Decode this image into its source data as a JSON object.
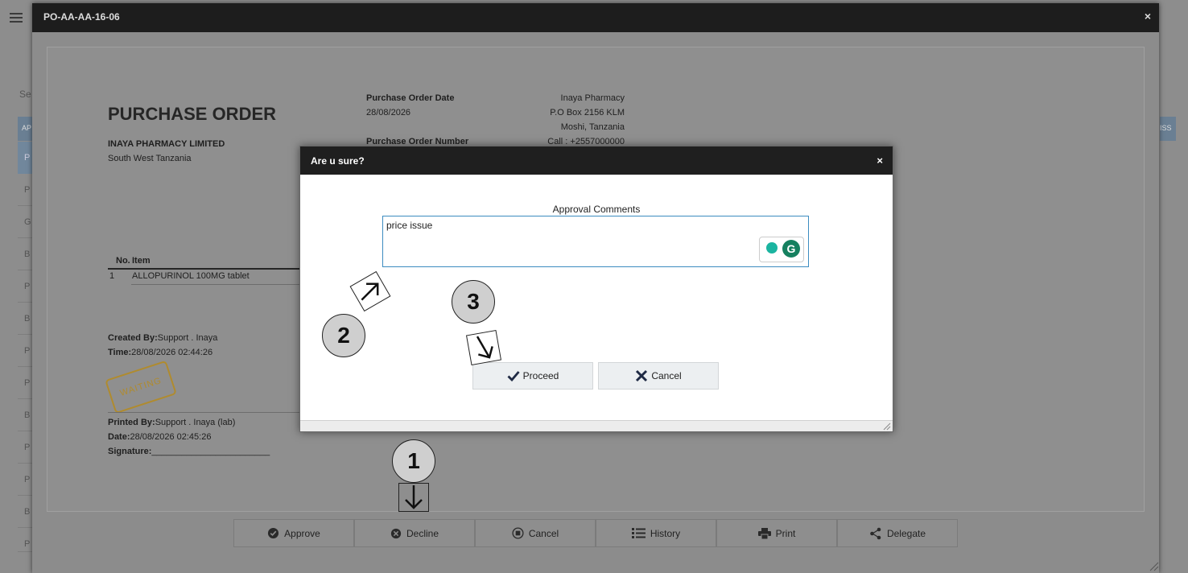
{
  "document_window": {
    "title": "PO-AA-AA-16-06",
    "close_symbol": "×"
  },
  "purchase_order": {
    "heading": "PURCHASE ORDER",
    "company_name": "INAYA PHARMACY LIMITED",
    "company_region": "South West Tanzania",
    "date_label": "Purchase Order Date",
    "date_value": "28/08/2026",
    "number_label": "Purchase Order Number",
    "address": {
      "name": "Inaya Pharmacy",
      "po_box": "P.O Box 2156 KLM",
      "city": "Moshi, Tanzania",
      "phone": "Call : +2557000000"
    },
    "table_headers": [
      "No.",
      "Item"
    ],
    "items": [
      {
        "no": "1",
        "item": "ALLOPURINOL 100MG tablet"
      }
    ],
    "created_by_label": "Created By:",
    "created_by_value": "Support . Inaya",
    "created_time_label": "Time:",
    "created_time_value": "28/08/2026 02:44:26",
    "stamp": "WAITING",
    "printed_by_label": "Printed By:",
    "printed_by_value": "Support . Inaya (lab)",
    "printed_date_label": "Date:",
    "printed_date_value": "28/08/2026 02:45:26",
    "signature_label": "Signature:",
    "signature_line": "________________________"
  },
  "action_bar": {
    "approve": "Approve",
    "decline": "Decline",
    "cancel": "Cancel",
    "history": "History",
    "print": "Print",
    "delegate": "Delegate"
  },
  "background_list": {
    "row_letters": [
      "P",
      "P",
      "G",
      "B",
      "P",
      "B",
      "P",
      "P",
      "B",
      "P",
      "P",
      "B",
      "P"
    ],
    "search_prefix": "Se",
    "header_prefix": "AP",
    "right_header": "ISS"
  },
  "dialog": {
    "title": "Are u sure?",
    "close_symbol": "×",
    "comments_label": "Approval Comments",
    "comments_value": "price issue ",
    "proceed_label": "Proceed",
    "cancel_label": "Cancel"
  },
  "annotations": {
    "step1": "1",
    "step2": "2",
    "step3": "3"
  },
  "colors": {
    "title_bar": "#1f1f1f",
    "textarea_border": "#3c8cc0",
    "stamp": "#b08b2e",
    "grammarly": "#15805f"
  }
}
